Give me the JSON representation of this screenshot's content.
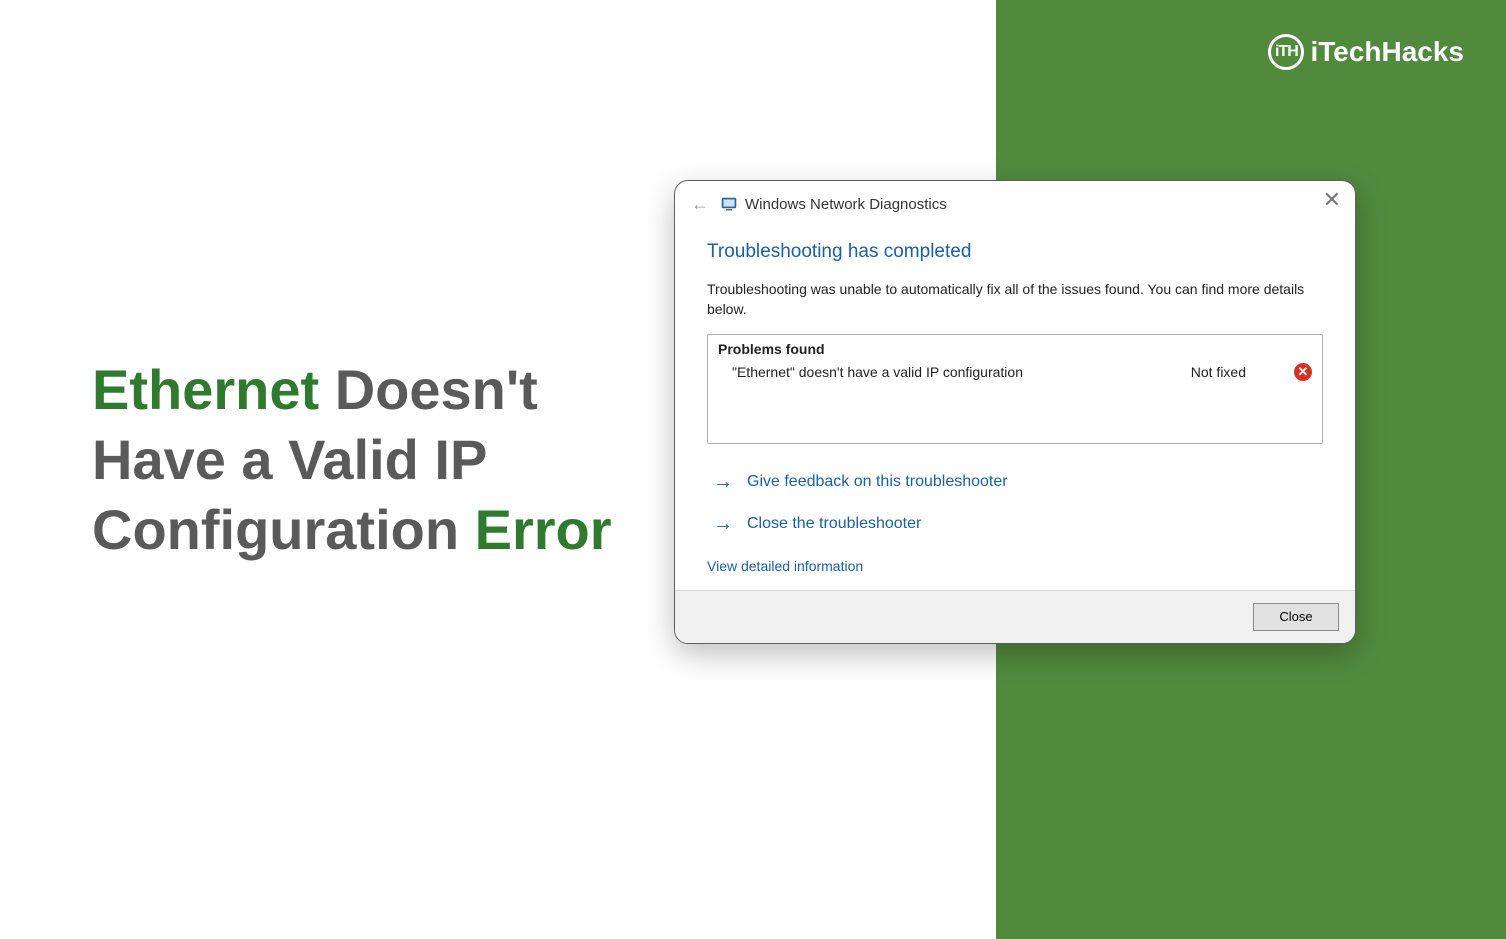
{
  "brand": {
    "name": "iTechHacks",
    "badge": "iTH"
  },
  "headline": {
    "word1": "Ethernet",
    "middle": " Doesn't Have a Valid IP Configuration ",
    "word2": "Error"
  },
  "dialog": {
    "title": "Windows Network Diagnostics",
    "heading": "Troubleshooting has completed",
    "description": "Troubleshooting was unable to automatically fix all of the issues found. You can find more details below.",
    "problems_label": "Problems found",
    "problems": [
      {
        "text": "\"Ethernet\" doesn't have a valid IP configuration",
        "status": "Not fixed"
      }
    ],
    "actions": {
      "feedback": "Give feedback on this troubleshooter",
      "close_troubleshooter": "Close the troubleshooter"
    },
    "detail_link": "View detailed information",
    "close_button": "Close"
  }
}
